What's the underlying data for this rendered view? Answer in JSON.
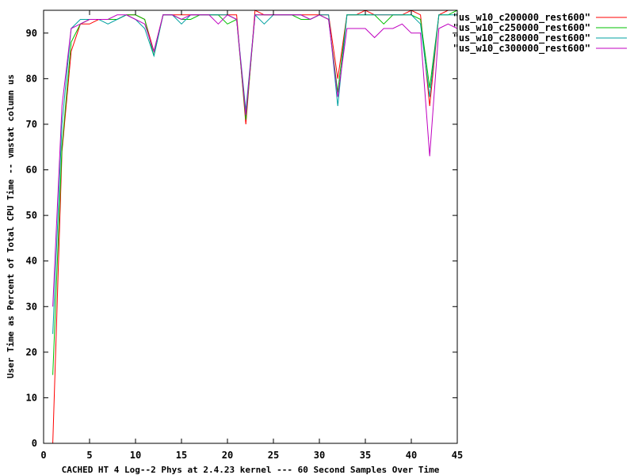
{
  "chart_data": {
    "type": "line",
    "title": "",
    "xlabel": "CACHED HT 4 Log--2 Phys at 2.4.23 kernel --- 60 Second Samples Over Time",
    "ylabel": "User Time as Percent of Total CPU Time -- vmstat column us",
    "xlim": [
      0,
      45
    ],
    "ylim": [
      0,
      95
    ],
    "x_ticks": [
      0,
      5,
      10,
      15,
      20,
      25,
      30,
      35,
      40,
      45
    ],
    "y_ticks": [
      0,
      10,
      20,
      30,
      40,
      50,
      60,
      70,
      80,
      90
    ],
    "grid": false,
    "legend_position": "right, outside plot",
    "x": [
      1,
      2,
      3,
      4,
      5,
      6,
      7,
      8,
      9,
      10,
      11,
      12,
      13,
      14,
      15,
      16,
      17,
      18,
      19,
      20,
      21,
      22,
      23,
      24,
      25,
      26,
      27,
      28,
      29,
      30,
      31,
      32,
      33,
      34,
      35,
      36,
      37,
      38,
      39,
      40,
      41,
      42,
      43,
      44,
      45
    ],
    "series": [
      {
        "name": "\"us_w10_c200000_rest600\"",
        "color": "#ff0000",
        "values": [
          0,
          64,
          86,
          92,
          92,
          93,
          93,
          93,
          94,
          94,
          93,
          86,
          94,
          94,
          94,
          94,
          94,
          94,
          94,
          94,
          94,
          70,
          95,
          94,
          94,
          94,
          94,
          94,
          94,
          94,
          94,
          80,
          94,
          94,
          95,
          94,
          94,
          94,
          94,
          95,
          94,
          74,
          94,
          95,
          95
        ]
      },
      {
        "name": "\"us_w10_c250000_rest600\"",
        "color": "#00c000",
        "values": [
          15,
          65,
          88,
          92,
          93,
          93,
          93,
          93,
          94,
          94,
          93,
          85,
          94,
          94,
          93,
          93,
          94,
          94,
          94,
          92,
          93,
          71,
          94,
          94,
          94,
          94,
          94,
          93,
          93,
          94,
          93,
          77,
          94,
          94,
          94,
          94,
          92,
          94,
          94,
          94,
          93,
          78,
          94,
          94,
          95
        ]
      },
      {
        "name": "\"us_w10_c280000_rest600\"",
        "color": "#00a0a0",
        "values": [
          24,
          70,
          91,
          93,
          93,
          93,
          92,
          93,
          94,
          93,
          91,
          85,
          94,
          94,
          92,
          94,
          94,
          94,
          94,
          94,
          93,
          73,
          94,
          92,
          94,
          94,
          94,
          94,
          93,
          94,
          94,
          74,
          94,
          94,
          94,
          94,
          94,
          94,
          94,
          94,
          92,
          76,
          94,
          94,
          94
        ]
      },
      {
        "name": "\"us_w10_c300000_rest600\"",
        "color": "#c000c0",
        "values": [
          30,
          74,
          91,
          92,
          93,
          93,
          93,
          94,
          94,
          93,
          92,
          86,
          94,
          94,
          93,
          94,
          94,
          94,
          92,
          94,
          93,
          72,
          94,
          94,
          94,
          94,
          94,
          94,
          93,
          94,
          93,
          76,
          91,
          91,
          91,
          89,
          91,
          91,
          92,
          90,
          90,
          63,
          91,
          92,
          91
        ]
      }
    ]
  }
}
